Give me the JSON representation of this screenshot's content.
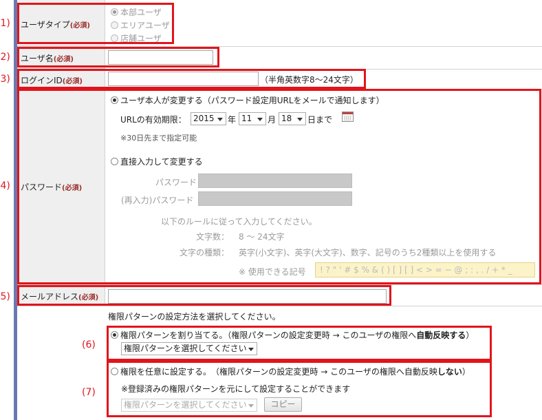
{
  "markers": [
    "(1)",
    "(2)",
    "(3)",
    "(4)",
    "(5)",
    "(6)",
    "(7)"
  ],
  "user_type": {
    "label": "ユーザタイプ",
    "required": "(必須)",
    "options": [
      "本部ユーザ",
      "エリアユーザ",
      "店舗ユーザ"
    ]
  },
  "user_name": {
    "label": "ユーザ名",
    "required": "(必須)",
    "value": ""
  },
  "login_id": {
    "label": "ログインID",
    "required": "(必須)",
    "value": "",
    "hint": "（半角英数字8〜24文字）"
  },
  "password": {
    "label": "パスワード",
    "required": "(必須)",
    "option_user": "ユーザ本人が変更する（パスワード設定用URLをメールで通知します）",
    "expiry_label": "URLの有効期限：",
    "year": "2015",
    "year_unit": "年",
    "month": "11",
    "month_unit": "月",
    "day": "18",
    "day_unit": "日まで",
    "note_30": "※30日先まで指定可能",
    "option_direct": "直接入力して変更する",
    "pw_label": "パスワード",
    "pw_confirm_label": "(再入力)パスワード",
    "rule_intro": "以下のルールに従って入力してください。",
    "rule_len_label": "文字数：",
    "rule_len_value": "8 〜 24文字",
    "rule_type_label": "文字の種類：",
    "rule_type_value": "英字(小文字)、英字(大文字)、数字、記号のうち2種類以上を使用する",
    "symbols_label": "※ 使用できる記号",
    "symbols": "! ? \" ' # $ % & ( ) [ ] [ ] < > = − @ ; : , . / + * _"
  },
  "email": {
    "label": "メールアドレス",
    "required": "(必須)",
    "value": ""
  },
  "permission": {
    "intro": "権限パターンの設定方法を選択してください。",
    "assign_text": "権限パターンを割り当てる。（権限パターンの設定変更時 → このユーザの権限へ",
    "assign_bold": "自動反映する",
    "assign_end": "）",
    "assign_select": "権限パターンを選択してください",
    "custom_text": "権限を任意に設定する。　（権限パターンの設定変更時 → このユーザの権限へ自動反映",
    "custom_bold": "しない",
    "custom_end": "）",
    "custom_note": "※登録済みの権限パターンを元にして設定することができます",
    "custom_select": "権限パターンを選択してください",
    "copy_button": "コピー"
  }
}
